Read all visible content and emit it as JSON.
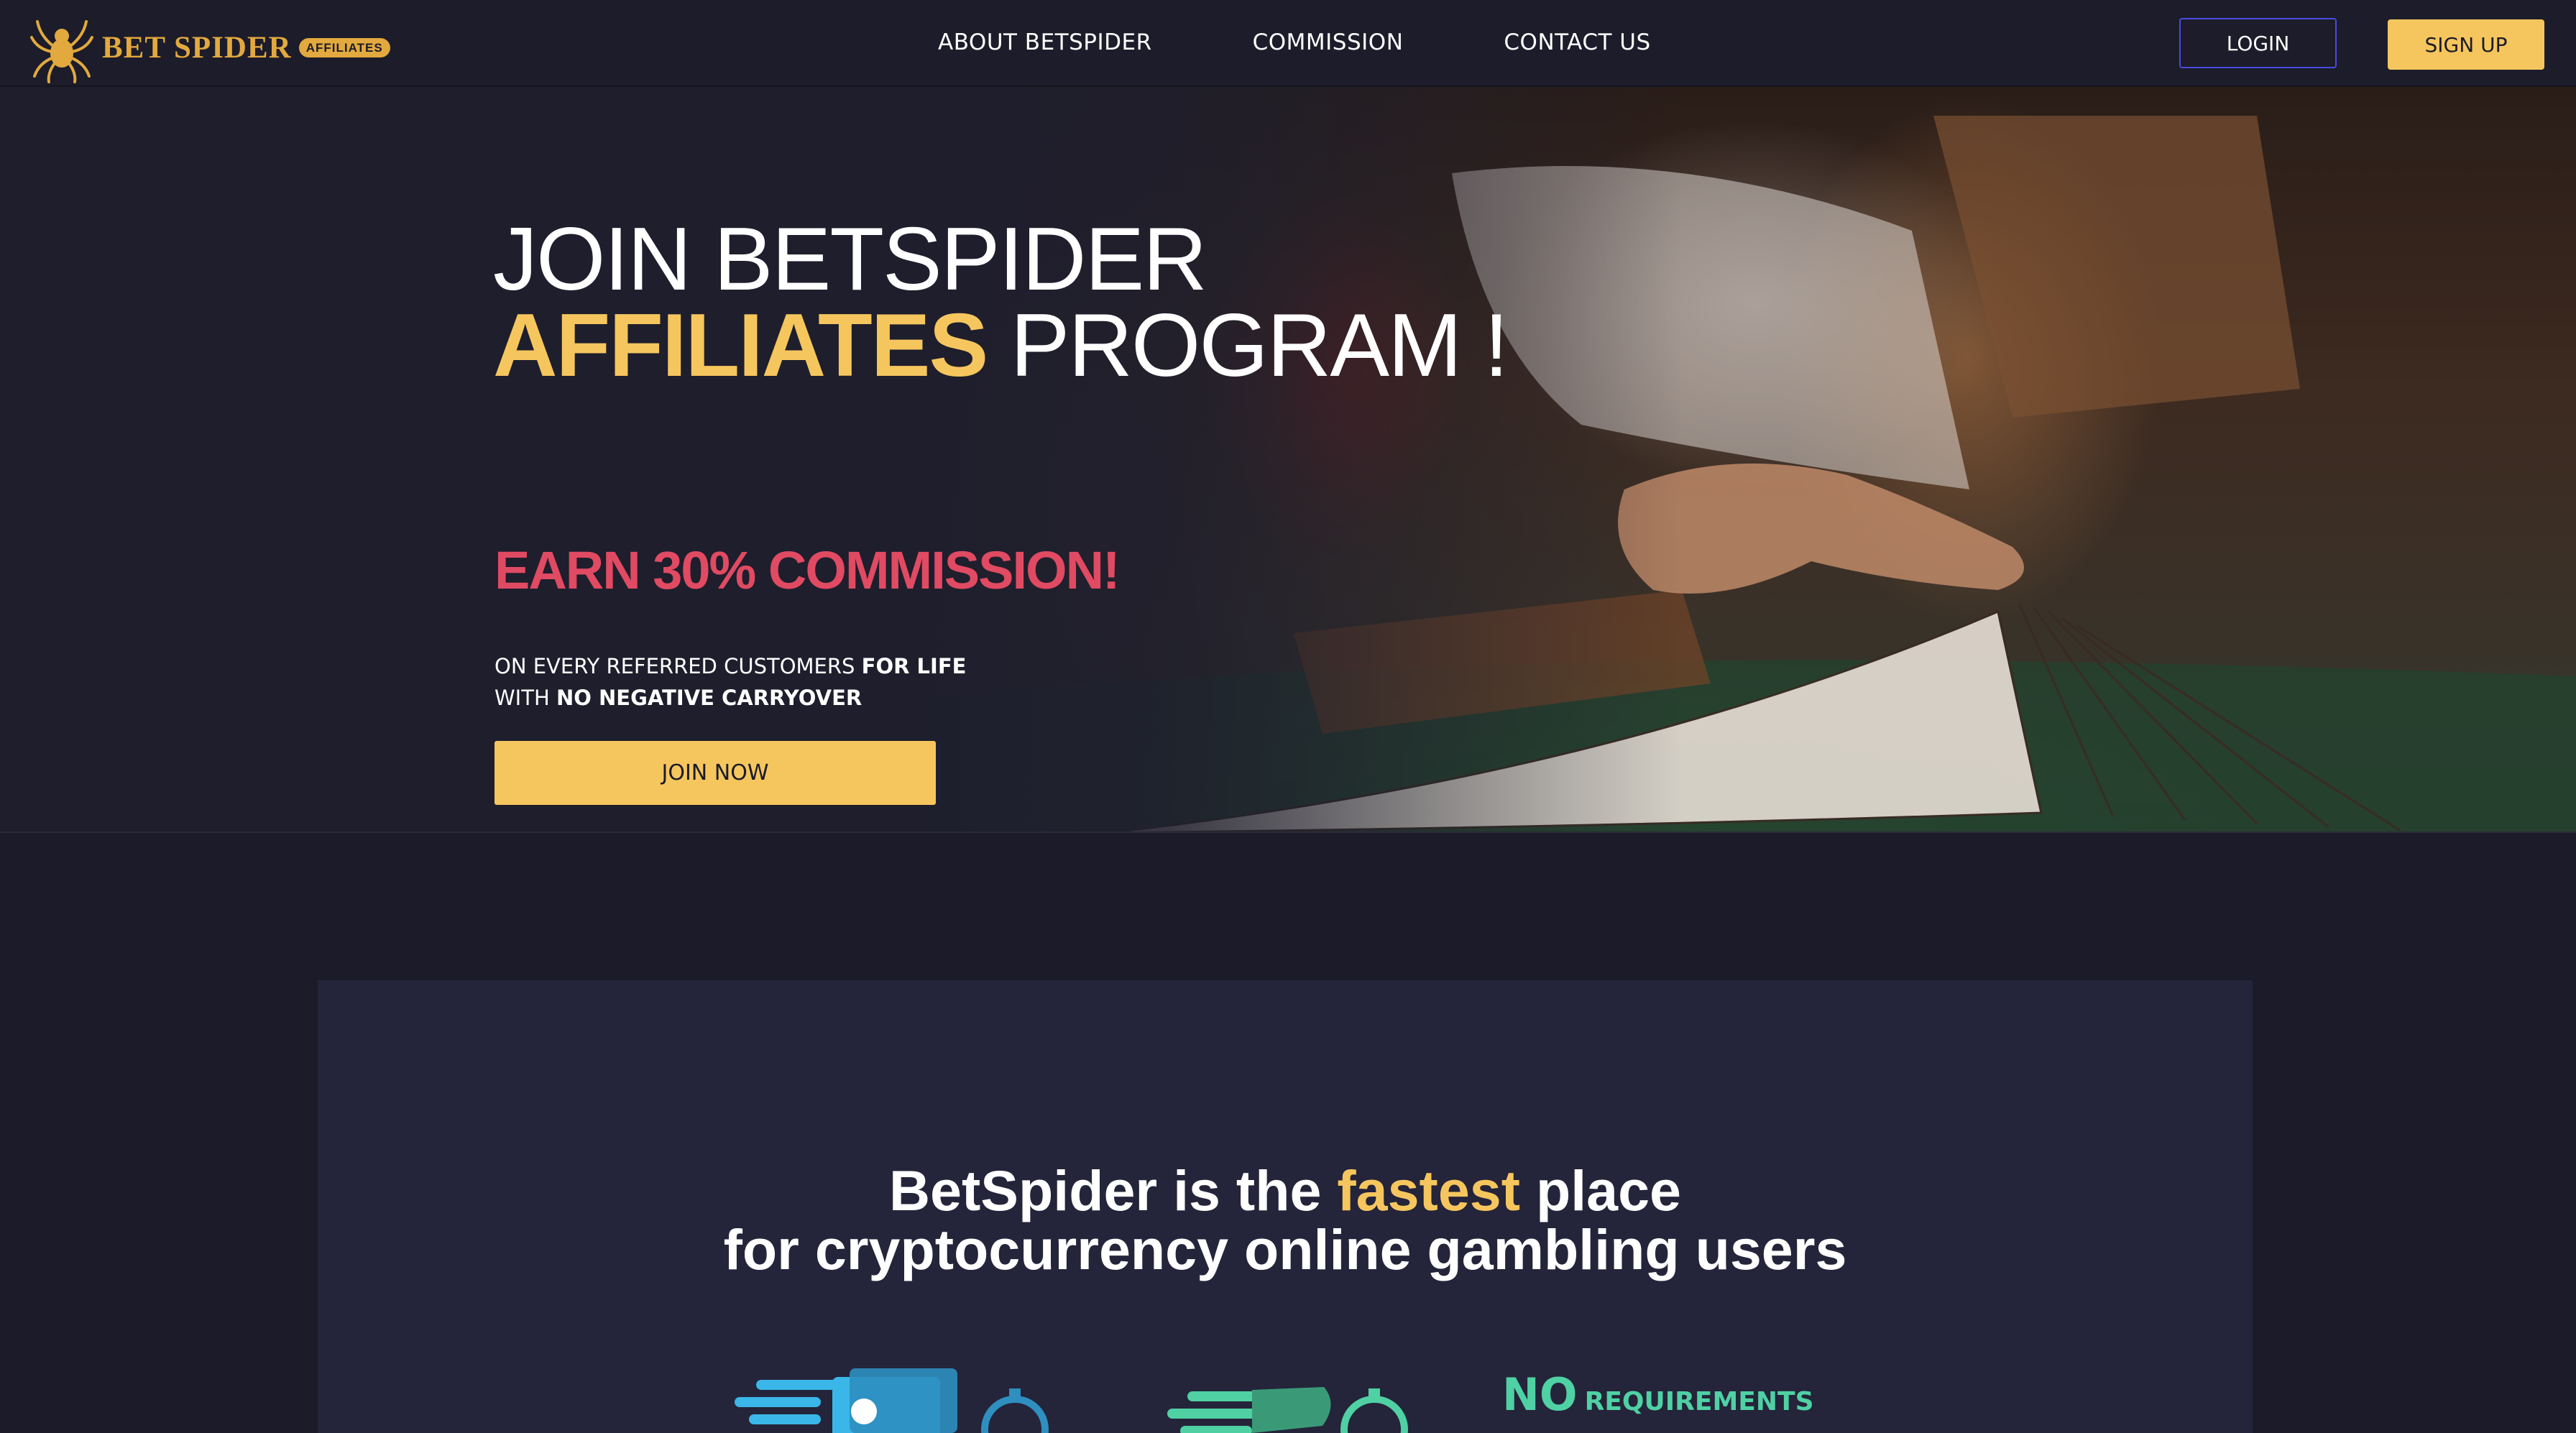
{
  "header": {
    "brand": "BET SPIDER",
    "brand_badge": "AFFILIATES",
    "nav": [
      {
        "label": "ABOUT BETSPIDER"
      },
      {
        "label": "COMMISSION"
      },
      {
        "label": "CONTACT US"
      }
    ],
    "login_label": "LOGIN",
    "signup_label": "SIGN UP"
  },
  "hero": {
    "title_line1": "JOIN BETSPIDER",
    "title_accent": "AFFILIATES",
    "title_rest": " PROGRAM !",
    "earn": "EARN 30% COMMISSION!",
    "sub_line1_a": "ON EVERY REFERRED CUSTOMERS ",
    "sub_line1_b": "FOR LIFE",
    "sub_line2_a": "WITH ",
    "sub_line2_b": "NO NEGATIVE CARRYOVER",
    "join_label": "JOIN NOW"
  },
  "info": {
    "title_a": "BetSpider is the ",
    "title_accent": "fastest",
    "title_b": " place",
    "title_line2": "for cryptocurrency online gambling users",
    "no_req_big": "NO",
    "no_req_small": "REQUIREMENTS"
  },
  "colors": {
    "accent": "#f6c65e",
    "earn": "#e04a62",
    "background": "#1b1b29",
    "panel": "#24243a",
    "login_border": "#4a4ae0",
    "feature_green": "#4fd1a3",
    "feature_blue": "#3ab7e8"
  }
}
